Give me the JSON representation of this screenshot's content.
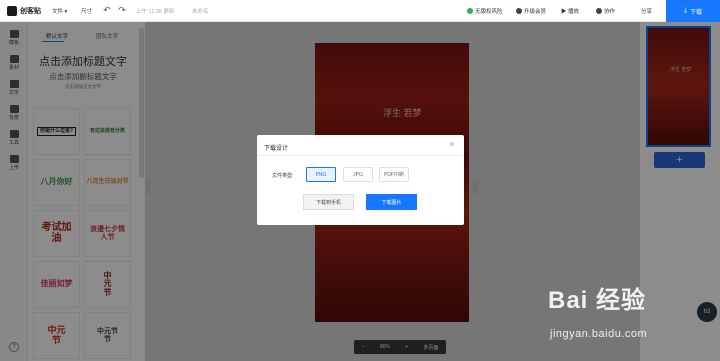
{
  "app": {
    "logo_text": "创客贴"
  },
  "topbar": {
    "file_menu": "文件",
    "size_menu": "尺寸",
    "save_status": "上午 11:38 更新",
    "untitled": "未命名",
    "no_copyright_risk": "无版权风险",
    "upgrade_vip": "升级会员",
    "play": "播放",
    "collaborate": "协作",
    "share": "分享",
    "download": "下载"
  },
  "rail": {
    "items": [
      {
        "label": "模板",
        "icon": "template-icon"
      },
      {
        "label": "素材",
        "icon": "material-icon"
      },
      {
        "label": "文字",
        "icon": "text-icon"
      },
      {
        "label": "背景",
        "icon": "background-icon"
      },
      {
        "label": "工具",
        "icon": "tools-icon"
      },
      {
        "label": "上传",
        "icon": "upload-icon"
      }
    ],
    "help": "?"
  },
  "panel": {
    "tabs": [
      {
        "label": "默认文字"
      },
      {
        "label": "团队文字"
      }
    ],
    "text_big": "点击添加标题文字",
    "text_mid": "点击添加副标题文字",
    "text_small": "点击添加正文文字",
    "cards": [
      {
        "text": "你是什么垃圾?",
        "color": "#222222"
      },
      {
        "text": "有垃圾就有分类",
        "color": "#2c7a3a"
      },
      {
        "text": "八月你好",
        "color": "#3a9a4a"
      },
      {
        "text": "八月生日派对节",
        "color": "#d9892b"
      },
      {
        "text": "考试加油",
        "color": "#b3261e"
      },
      {
        "text": "浪漫七夕情人节",
        "color": "#c23a4a"
      },
      {
        "text": "佳丽如梦",
        "color": "#d0356a"
      },
      {
        "text": "中元节",
        "color": "#7a2a1a"
      },
      {
        "text": "中元节",
        "color": "#c8281e"
      },
      {
        "text": "中元节节",
        "color": "#3a3a3a"
      }
    ]
  },
  "canvas": {
    "title_text": "浮生 若梦"
  },
  "zoombar": {
    "minus": "−",
    "zoom": "96%",
    "plus": "+",
    "multi_page": "多页面"
  },
  "dialog": {
    "title": "下载设计",
    "file_type_label": "文件类型:",
    "formats": [
      "PNG",
      "JPG",
      "PDF印刷"
    ],
    "selected_format": "PNG",
    "download_to_phone": "下载到手机",
    "download_image": "下载图片"
  },
  "right_panel": {
    "add_page": "+",
    "page_badge": "63"
  },
  "watermark": {
    "brand": "Bai 经验",
    "url": "jingyan.baidu.com"
  },
  "colors": {
    "accent": "#1677ff",
    "canvas_red": "#9e1f14"
  }
}
